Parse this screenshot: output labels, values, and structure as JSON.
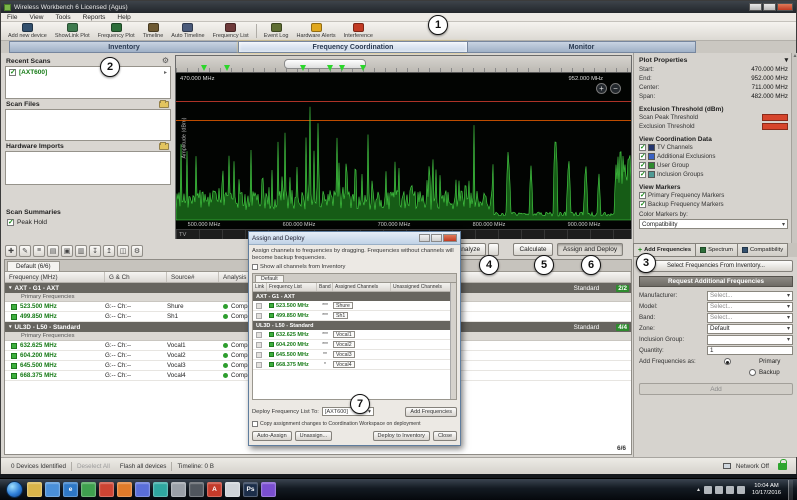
{
  "window": {
    "title": "Wireless Workbench 6 Licensed (Agus)"
  },
  "menu": {
    "items": [
      "File",
      "View",
      "Tools",
      "Reports",
      "Help"
    ]
  },
  "toolbar": {
    "items": [
      {
        "label": "Add new device",
        "color": "#33506e"
      },
      {
        "label": "ShowLink Plot",
        "color": "#3e7a4e"
      },
      {
        "label": "Frequency Plot",
        "color": "#2d6e3a"
      },
      {
        "label": "Timeline",
        "color": "#6e5a33"
      },
      {
        "label": "Auto Timeline",
        "color": "#4a5a7a"
      },
      {
        "label": "Frequency List",
        "color": "#6e3a3a"
      },
      {
        "label": "Event Log",
        "color": "#5f6e33"
      },
      {
        "label": "Hardware Alerts",
        "color": "#e0a81f"
      },
      {
        "label": "Interference",
        "color": "#c23b24"
      }
    ]
  },
  "main_tabs": {
    "inventory": "Inventory",
    "frequency_coordination": "Frequency Coordination",
    "monitor": "Monitor"
  },
  "callouts": {
    "c1": "1",
    "c2": "2",
    "c3": "3",
    "c4": "4",
    "c5": "5",
    "c6": "6",
    "c7": "7"
  },
  "sidebar": {
    "recent_scans_title": "Recent Scans",
    "recent_scan_item": "[AXT600]",
    "scan_files_title": "Scan Files",
    "hardware_imports_title": "Hardware Imports",
    "scan_summaries_title": "Scan Summaries",
    "peak_hold_label": "Peak Hold"
  },
  "plot": {
    "start_label": "470.000 MHz",
    "end_label": "952.000 MHz",
    "y_label": "Amplitude (dBm)",
    "x_ticks": [
      "500.000 MHz",
      "600.000 MHz",
      "700.000 MHz",
      "800.000 MHz",
      "900.000 MHz"
    ],
    "tv_label": "TV",
    "freq_start_mhz": 470,
    "freq_end_mhz": 952,
    "marker_freqs_mhz": [
      499.85,
      523.5,
      604.2,
      632.625,
      645.5,
      668.375
    ],
    "sparse_peaks": [
      [
        822,
        70
      ],
      [
        846,
        52
      ],
      [
        872,
        84
      ],
      [
        886,
        60
      ],
      [
        904,
        56
      ],
      [
        918,
        48
      ]
    ]
  },
  "plot_properties": {
    "title": "Plot Properties",
    "start_label": "Start:",
    "start": "470.000 MHz",
    "end_label": "End:",
    "end": "952.000 MHz",
    "center_label": "Center:",
    "center": "711.000 MHz",
    "span_label": "Span:",
    "span": "482.000 MHz"
  },
  "thresholds": {
    "title": "Exclusion Threshold (dBm)",
    "scan_peak_label": "Scan Peak Threshold",
    "exclusion_label": "Exclusion Threshold"
  },
  "view_coordination": {
    "title": "View Coordination Data",
    "items": [
      {
        "label": "TV Channels",
        "color": "#24356e"
      },
      {
        "label": "Additional Exclusions",
        "color": "#3a62c4"
      },
      {
        "label": "User Group",
        "color": "#2e8b2e"
      },
      {
        "label": "Inclusion Groups",
        "color": "#4f9a94"
      }
    ]
  },
  "view_markers": {
    "title": "View Markers",
    "primary": "Primary Frequency Markers",
    "backup": "Backup Frequency Markers",
    "color_by_label": "Color Markers by:",
    "color_by_value": "Compatibility"
  },
  "actions": {
    "analyze": "Analyze",
    "calculate": "Calculate",
    "assign_deploy": "Assign and Deploy"
  },
  "right_tabs": {
    "add_frequencies": "Add Frequencies",
    "spectrum": "Spectrum",
    "compatibility": "Compatibility"
  },
  "add_panel": {
    "select_inventory": "Select Frequencies From Inventory...",
    "request_header": "Request Additional Frequencies",
    "manufacturer_label": "Manufacturer:",
    "manufacturer_value": "Select...",
    "model_label": "Model:",
    "model_value": "Select...",
    "band_label": "Band:",
    "band_value": "Select...",
    "zone_label": "Zone:",
    "zone_value": "Default",
    "inclusion_label": "Inclusion Group:",
    "inclusion_value": "",
    "quantity_label": "Quantity:",
    "quantity_value": "1",
    "add_as_label": "Add Frequencies as:",
    "primary_label": "Primary",
    "backup_label": "Backup",
    "add_button": "Add"
  },
  "freq_table": {
    "tab": "Default (6/6)",
    "columns": [
      "Frequency (MHz)",
      "G & Ch",
      "Source#",
      "Analysis Results"
    ],
    "groups": [
      {
        "name": "AXT - G1 - AXT",
        "zone": "Standard",
        "count": "2/2",
        "sub": "Primary Frequencies",
        "rows": [
          {
            "freq": "523.500 MHz",
            "gch": "G:-- Ch:--",
            "source": "Shure",
            "result": "Compatible"
          },
          {
            "freq": "499.850 MHz",
            "gch": "G:-- Ch:--",
            "source": "Sh1",
            "result": "Compatible"
          }
        ]
      },
      {
        "name": "UL3D - L50 - Standard",
        "zone": "Standard",
        "count": "4/4",
        "sub": "Primary Frequencies",
        "rows": [
          {
            "freq": "632.625 MHz",
            "gch": "G:-- Ch:--",
            "source": "Vocal1",
            "result": "Compatible"
          },
          {
            "freq": "604.200 MHz",
            "gch": "G:-- Ch:--",
            "source": "Vocal2",
            "result": "Compatible"
          },
          {
            "freq": "645.500 MHz",
            "gch": "G:-- Ch:--",
            "source": "Vocal3",
            "result": "Compatible"
          },
          {
            "freq": "668.375 MHz",
            "gch": "G:-- Ch:--",
            "source": "Vocal4",
            "result": "Compatible"
          }
        ]
      }
    ],
    "total": "6/6"
  },
  "dialog": {
    "title": "Assign and Deploy",
    "description": "Assign channels to frequencies by dragging. Frequencies without channels will become backup frequencies.",
    "show_all": "Show all channels from Inventory",
    "tab": "Default",
    "columns": [
      "Link",
      "Frequency List",
      "Band",
      "Assigned Channels",
      "Unassigned Channels"
    ],
    "groups": [
      {
        "name": "AXT - G1 - AXT",
        "rows": [
          {
            "freq": "523.500 MHz",
            "band": "***",
            "assigned": "Shure"
          },
          {
            "freq": "499.850 MHz",
            "band": "***",
            "assigned": "Sh1"
          }
        ]
      },
      {
        "name": "UL3D - L50 - Standard",
        "rows": [
          {
            "freq": "632.625 MHz",
            "band": "***",
            "assigned": "Vocal1"
          },
          {
            "freq": "604.200 MHz",
            "band": "***",
            "assigned": "Vocal2"
          },
          {
            "freq": "645.500 MHz",
            "band": "**",
            "assigned": "Vocal3"
          },
          {
            "freq": "668.375 MHz",
            "band": "*",
            "assigned": "Vocal4"
          }
        ]
      }
    ],
    "deploy_label": "Deploy Frequency List To:",
    "deploy_value": "[AXT600]",
    "add_frequencies": "Add Frequencies",
    "copy_label": "Copy assignment changes to Coordination Workspace on deployment",
    "auto_assign": "Auto-Assign",
    "unassign": "Unassign...",
    "deploy_btn": "Deploy to Inventory",
    "close_btn": "Close"
  },
  "status_bar": {
    "devices": "0 Devices Identified",
    "deselect": "Deselect All",
    "flash": "Flash all devices",
    "timeline": "Timeline: 0 B",
    "network": "Network Off"
  },
  "taskbar": {
    "time": "10:04 AM",
    "date": "10/17/2016",
    "icons": [
      {
        "name": "windows-explorer-icon",
        "color": "#d9b44a"
      },
      {
        "name": "media-player-icon",
        "color": "#4a90d9"
      },
      {
        "name": "internet-explorer-icon",
        "color": "#2e78c7",
        "glyph": "e"
      },
      {
        "name": "app-icon-green",
        "color": "#3fa04f"
      },
      {
        "name": "chrome-icon",
        "color": "#cc4433"
      },
      {
        "name": "firefox-icon",
        "color": "#e07b2a"
      },
      {
        "name": "app-icon-blue",
        "color": "#5a6fd9"
      },
      {
        "name": "app-icon-teal",
        "color": "#2fa7a0"
      },
      {
        "name": "app-icon-gray",
        "color": "#9aa0a8"
      },
      {
        "name": "app-icon-dark",
        "color": "#50565e"
      },
      {
        "name": "acrobat-icon",
        "color": "#c43a2a",
        "glyph": "A"
      },
      {
        "name": "app-icon-light",
        "color": "#cfd3d8"
      },
      {
        "name": "photoshop-icon",
        "color": "#1c2e4a",
        "glyph": "Ps"
      },
      {
        "name": "app-icon-purple",
        "color": "#7a4fd0"
      }
    ]
  },
  "icons": {
    "check": "✓",
    "gear": "⚙",
    "dropdown": "▾",
    "chevron_right": "▸",
    "zoom_in": "+",
    "zoom_out": "−",
    "tray_expand": "▲",
    "table_tools": [
      "✚",
      "✎",
      "≡",
      "▤",
      "▣",
      "▥",
      "↧",
      "↥",
      "◫",
      "⚙"
    ]
  }
}
